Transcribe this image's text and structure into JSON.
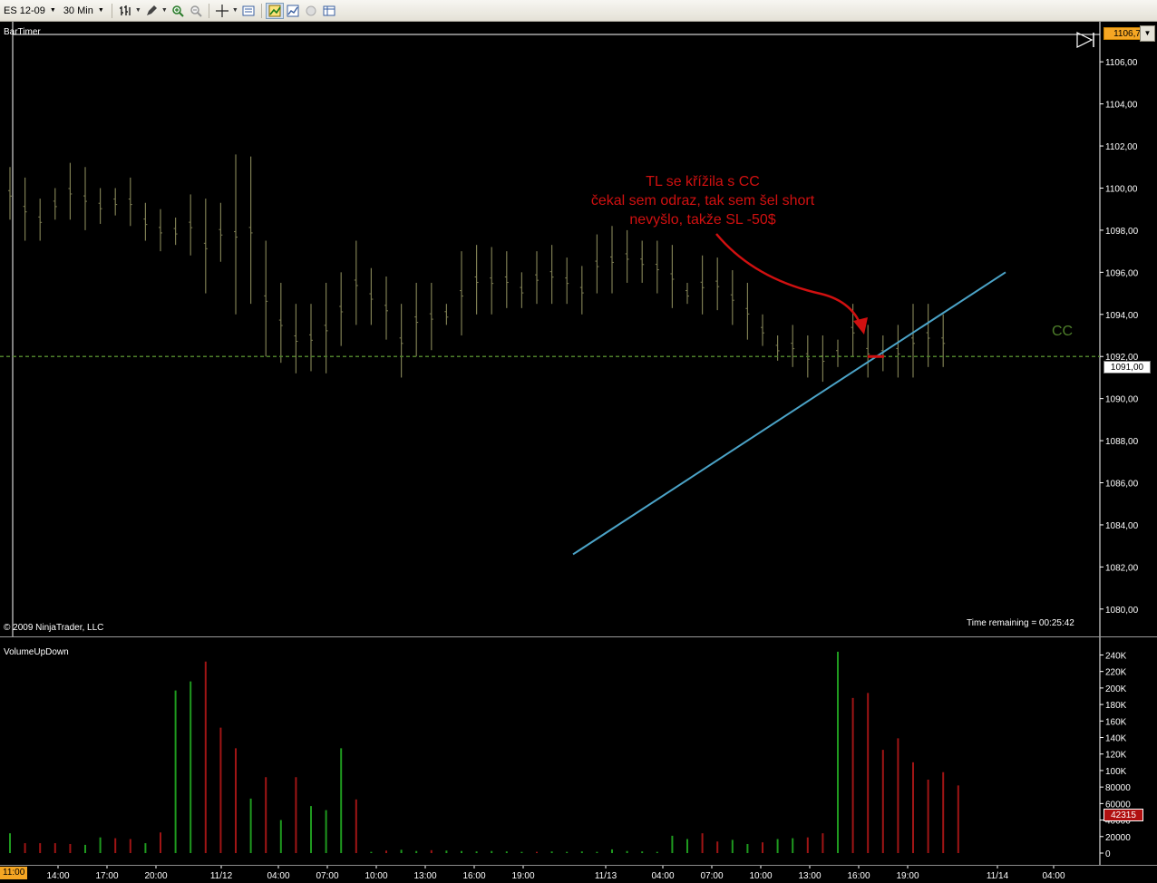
{
  "toolbar": {
    "instrument": "ES 12-09",
    "interval": "30 Min"
  },
  "price_panel": {
    "indicator_label": "BarTimer",
    "copyright": "© 2009 NinjaTrader, LLC",
    "time_remaining": "Time remaining = 00:25:42",
    "last_price_badge": "1106,7",
    "close_price_badge": "1091,00",
    "cc_label": "CC",
    "annotation_lines": [
      "TL se křížila s CC",
      "čekal sem odraz, tak sem šel short",
      "nevyšlo, takže SL -50$"
    ],
    "colors": {
      "bar": "#7d7d52",
      "trendline": "#4ba3c7",
      "cc_line": "#4e7f2a",
      "annotation": "#d01010"
    }
  },
  "volume_panel": {
    "indicator_label": "VolumeUpDown",
    "current_volume_badge": "42315",
    "colors": {
      "up": "#1f9a1f",
      "down": "#a01515"
    }
  },
  "chart_data": [
    {
      "type": "ohlc",
      "title": "",
      "y_ticks": [
        "1106,00",
        "1104,00",
        "1102,00",
        "1100,00",
        "1098,00",
        "1096,00",
        "1094,00",
        "1092,00",
        "1090,00",
        "1088,00",
        "1086,00",
        "1084,00",
        "1082,00",
        "1080,00"
      ],
      "ylim": [
        1078.7,
        1107.3
      ],
      "cc_level": 1092.0,
      "trendline": {
        "from": [
          0.0,
          1082.6
        ],
        "to": [
          71.2,
          1096.0
        ]
      },
      "bar_step": 6.0,
      "bars": [
        {
          "h": 1101.0,
          "l": 1098.5
        },
        {
          "h": 1100.5,
          "l": 1097.5
        },
        {
          "h": 1099.5,
          "l": 1097.5
        },
        {
          "h": 1100.0,
          "l": 1098.5
        },
        {
          "h": 1101.2,
          "l": 1098.5
        },
        {
          "h": 1101.0,
          "l": 1098.0
        },
        {
          "h": 1100.0,
          "l": 1098.3
        },
        {
          "h": 1100.0,
          "l": 1098.7
        },
        {
          "h": 1100.5,
          "l": 1098.2
        },
        {
          "h": 1099.3,
          "l": 1097.5
        },
        {
          "h": 1099.0,
          "l": 1097.0
        },
        {
          "h": 1098.6,
          "l": 1097.3
        },
        {
          "h": 1099.7,
          "l": 1096.8
        },
        {
          "h": 1099.5,
          "l": 1095.0
        },
        {
          "h": 1099.3,
          "l": 1096.5
        },
        {
          "h": 1101.6,
          "l": 1094.0
        },
        {
          "h": 1101.5,
          "l": 1094.5
        },
        {
          "h": 1097.5,
          "l": 1092.0
        },
        {
          "h": 1095.5,
          "l": 1091.7
        },
        {
          "h": 1094.5,
          "l": 1091.2
        },
        {
          "h": 1094.5,
          "l": 1091.3
        },
        {
          "h": 1095.5,
          "l": 1091.2
        },
        {
          "h": 1096.0,
          "l": 1092.5
        },
        {
          "h": 1097.5,
          "l": 1093.5
        },
        {
          "h": 1096.2,
          "l": 1093.5
        },
        {
          "h": 1095.8,
          "l": 1092.8
        },
        {
          "h": 1094.5,
          "l": 1091.0
        },
        {
          "h": 1095.5,
          "l": 1092.0
        },
        {
          "h": 1095.5,
          "l": 1092.3
        },
        {
          "h": 1094.5,
          "l": 1093.5
        },
        {
          "h": 1097.0,
          "l": 1093.0
        },
        {
          "h": 1097.3,
          "l": 1094.0
        },
        {
          "h": 1097.2,
          "l": 1094.0
        },
        {
          "h": 1097.0,
          "l": 1094.3
        },
        {
          "h": 1096.0,
          "l": 1094.3
        },
        {
          "h": 1097.0,
          "l": 1094.5
        },
        {
          "h": 1097.3,
          "l": 1094.5
        },
        {
          "h": 1096.7,
          "l": 1094.5
        },
        {
          "h": 1096.3,
          "l": 1094.0
        },
        {
          "h": 1097.8,
          "l": 1095.0
        },
        {
          "h": 1098.2,
          "l": 1095.0
        },
        {
          "h": 1098.0,
          "l": 1095.5
        },
        {
          "h": 1097.5,
          "l": 1095.5
        },
        {
          "h": 1097.5,
          "l": 1095.0
        },
        {
          "h": 1097.3,
          "l": 1094.3
        },
        {
          "h": 1095.5,
          "l": 1094.5
        },
        {
          "h": 1096.8,
          "l": 1094.0
        },
        {
          "h": 1096.7,
          "l": 1094.2
        },
        {
          "h": 1096.1,
          "l": 1093.5
        },
        {
          "h": 1095.5,
          "l": 1092.8
        },
        {
          "h": 1094.0,
          "l": 1092.5
        },
        {
          "h": 1093.0,
          "l": 1091.8
        },
        {
          "h": 1093.5,
          "l": 1091.5
        },
        {
          "h": 1093.0,
          "l": 1091.0
        },
        {
          "h": 1093.0,
          "l": 1090.8
        },
        {
          "h": 1092.8,
          "l": 1091.5
        },
        {
          "h": 1094.5,
          "l": 1092.0
        },
        {
          "h": 1093.5,
          "l": 1091.0
        },
        {
          "h": 1093.0,
          "l": 1091.3
        },
        {
          "h": 1093.5,
          "l": 1091.0
        },
        {
          "h": 1094.5,
          "l": 1091.0
        },
        {
          "h": 1094.5,
          "l": 1091.5
        },
        {
          "h": 1094.0,
          "l": 1091.5
        }
      ],
      "volume": {
        "y_ticks": [
          "240K",
          "220K",
          "200K",
          "180K",
          "160K",
          "140K",
          "120K",
          "100K",
          "80000",
          "60000",
          "40000",
          "20000",
          "0"
        ],
        "ylim": [
          0,
          246000
        ],
        "bar_step": 9.07,
        "bars": [
          {
            "v": 24000,
            "d": "up"
          },
          {
            "v": 12000,
            "d": "down"
          },
          {
            "v": 12000,
            "d": "down"
          },
          {
            "v": 12000,
            "d": "down"
          },
          {
            "v": 11000,
            "d": "down"
          },
          {
            "v": 10000,
            "d": "up"
          },
          {
            "v": 19000,
            "d": "up"
          },
          {
            "v": 18000,
            "d": "down"
          },
          {
            "v": 17000,
            "d": "down"
          },
          {
            "v": 12000,
            "d": "up"
          },
          {
            "v": 25000,
            "d": "down"
          },
          {
            "v": 197000,
            "d": "up"
          },
          {
            "v": 208000,
            "d": "up"
          },
          {
            "v": 232000,
            "d": "down"
          },
          {
            "v": 152000,
            "d": "down"
          },
          {
            "v": 127000,
            "d": "down"
          },
          {
            "v": 66000,
            "d": "up"
          },
          {
            "v": 92000,
            "d": "down"
          },
          {
            "v": 40000,
            "d": "up"
          },
          {
            "v": 92000,
            "d": "down"
          },
          {
            "v": 57000,
            "d": "up"
          },
          {
            "v": 52000,
            "d": "up"
          },
          {
            "v": 127000,
            "d": "up"
          },
          {
            "v": 65000,
            "d": "down"
          },
          {
            "v": 1500,
            "d": "up"
          },
          {
            "v": 3000,
            "d": "down"
          },
          {
            "v": 4000,
            "d": "up"
          },
          {
            "v": 2500,
            "d": "up"
          },
          {
            "v": 3500,
            "d": "down"
          },
          {
            "v": 3000,
            "d": "up"
          },
          {
            "v": 2500,
            "d": "up"
          },
          {
            "v": 2000,
            "d": "up"
          },
          {
            "v": 2500,
            "d": "up"
          },
          {
            "v": 2000,
            "d": "up"
          },
          {
            "v": 1500,
            "d": "up"
          },
          {
            "v": 1500,
            "d": "down"
          },
          {
            "v": 2000,
            "d": "up"
          },
          {
            "v": 1500,
            "d": "up"
          },
          {
            "v": 2000,
            "d": "up"
          },
          {
            "v": 1500,
            "d": "up"
          },
          {
            "v": 4500,
            "d": "up"
          },
          {
            "v": 2500,
            "d": "up"
          },
          {
            "v": 2000,
            "d": "up"
          },
          {
            "v": 1500,
            "d": "up"
          },
          {
            "v": 21000,
            "d": "up"
          },
          {
            "v": 17000,
            "d": "up"
          },
          {
            "v": 24000,
            "d": "down"
          },
          {
            "v": 14000,
            "d": "down"
          },
          {
            "v": 16000,
            "d": "up"
          },
          {
            "v": 11000,
            "d": "up"
          },
          {
            "v": 13000,
            "d": "down"
          },
          {
            "v": 17000,
            "d": "up"
          },
          {
            "v": 18000,
            "d": "up"
          },
          {
            "v": 19000,
            "d": "down"
          },
          {
            "v": 24000,
            "d": "down"
          },
          {
            "v": 244000,
            "d": "up"
          },
          {
            "v": 188000,
            "d": "down"
          },
          {
            "v": 194000,
            "d": "down"
          },
          {
            "v": 125000,
            "d": "down"
          },
          {
            "v": 139000,
            "d": "down"
          },
          {
            "v": 110000,
            "d": "down"
          },
          {
            "v": 89000,
            "d": "down"
          },
          {
            "v": 98000,
            "d": "down"
          },
          {
            "v": 82000,
            "d": "down"
          }
        ]
      }
    }
  ],
  "x_axis": {
    "start_badge": "11:00",
    "labels": [
      "14:00",
      "17:00",
      "20:00",
      "11/12",
      "04:00",
      "07:00",
      "10:00",
      "13:00",
      "16:00",
      "19:00",
      "11/13",
      "04:00",
      "07:00",
      "10:00",
      "13:00",
      "16:00",
      "19:00",
      "11/14",
      "04:00"
    ]
  }
}
